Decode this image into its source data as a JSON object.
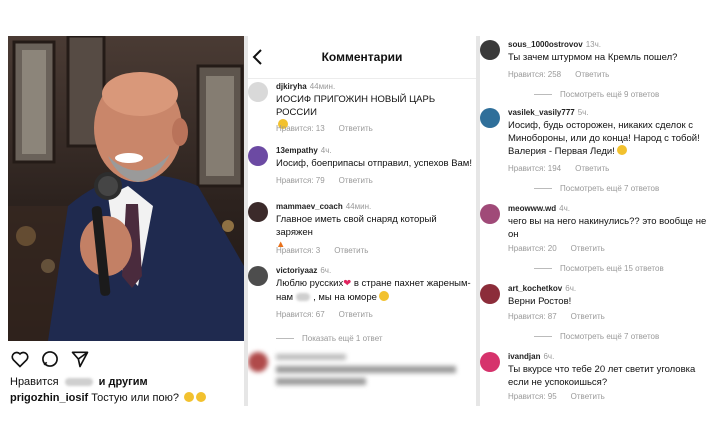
{
  "post": {
    "likes_label": "Нравится",
    "likes_and": "и другим",
    "author": "prigozhin_iosif",
    "caption": "Тостую или пою?"
  },
  "comments_panel": {
    "title": "Комментарии",
    "comments": [
      {
        "user": "djkiryha",
        "time": "44мин.",
        "text": "ИОСИФ ПРИГОЖИН НОВЫЙ ЦАРЬ РОССИИ",
        "likes": "Нравится: 13",
        "reply": "Ответить"
      },
      {
        "user": "13empathy",
        "time": "4ч.",
        "text": "Иосиф, боеприпасы отправил, успехов Вам!",
        "likes": "Нравится: 79",
        "reply": "Ответить"
      },
      {
        "user": "mammaev_coach",
        "time": "44мин.",
        "text": "Главное иметь свой снаряд который заряжен",
        "likes": "Нравится: 3",
        "reply": "Ответить"
      },
      {
        "user": "victoriyaaz",
        "time": "6ч.",
        "text_a": "Люблю русских",
        "text_b": "в стране пахнет жареным-",
        "text_c": "нам",
        "text_d": ", мы на юморе",
        "likes": "Нравится: 67",
        "reply": "Ответить",
        "replies": "Показать ещё 1 ответ"
      }
    ]
  },
  "more_panel": {
    "comments": [
      {
        "user": "sous_1000ostrovov",
        "time": "13ч.",
        "text": "Ты зачем штурмом на Кремль пошел?",
        "likes": "Нравится: 258",
        "reply": "Ответить",
        "replies": "Посмотреть ещё 9 ответов"
      },
      {
        "user": "vasilek_vasily777",
        "time": "5ч.",
        "text": "Иосиф, будь осторожен, никаких сделок с Минобороны, или до конца! Народ с тобой! Валерия - Первая Леди!",
        "likes": "Нравится: 194",
        "reply": "Ответить",
        "replies": "Посмотреть ещё 7 ответов"
      },
      {
        "user": "meowww.wd",
        "time": "4ч.",
        "text": "чего вы на него накинулись?? это вообще не он",
        "likes": "Нравится: 20",
        "reply": "Ответить",
        "replies": "Посмотреть ещё 15 ответов"
      },
      {
        "user": "art_kochetkov",
        "time": "6ч.",
        "text": "Верни Ростов!",
        "likes": "Нравится: 87",
        "reply": "Ответить",
        "replies": "Посмотреть ещё 7 ответов"
      },
      {
        "user": "ivandjan",
        "time": "6ч.",
        "text": "Ты вкурсе что тебе 20 лет светит уголовка если не успокоишься?",
        "likes": "Нравится: 95",
        "reply": "Ответить"
      }
    ]
  }
}
